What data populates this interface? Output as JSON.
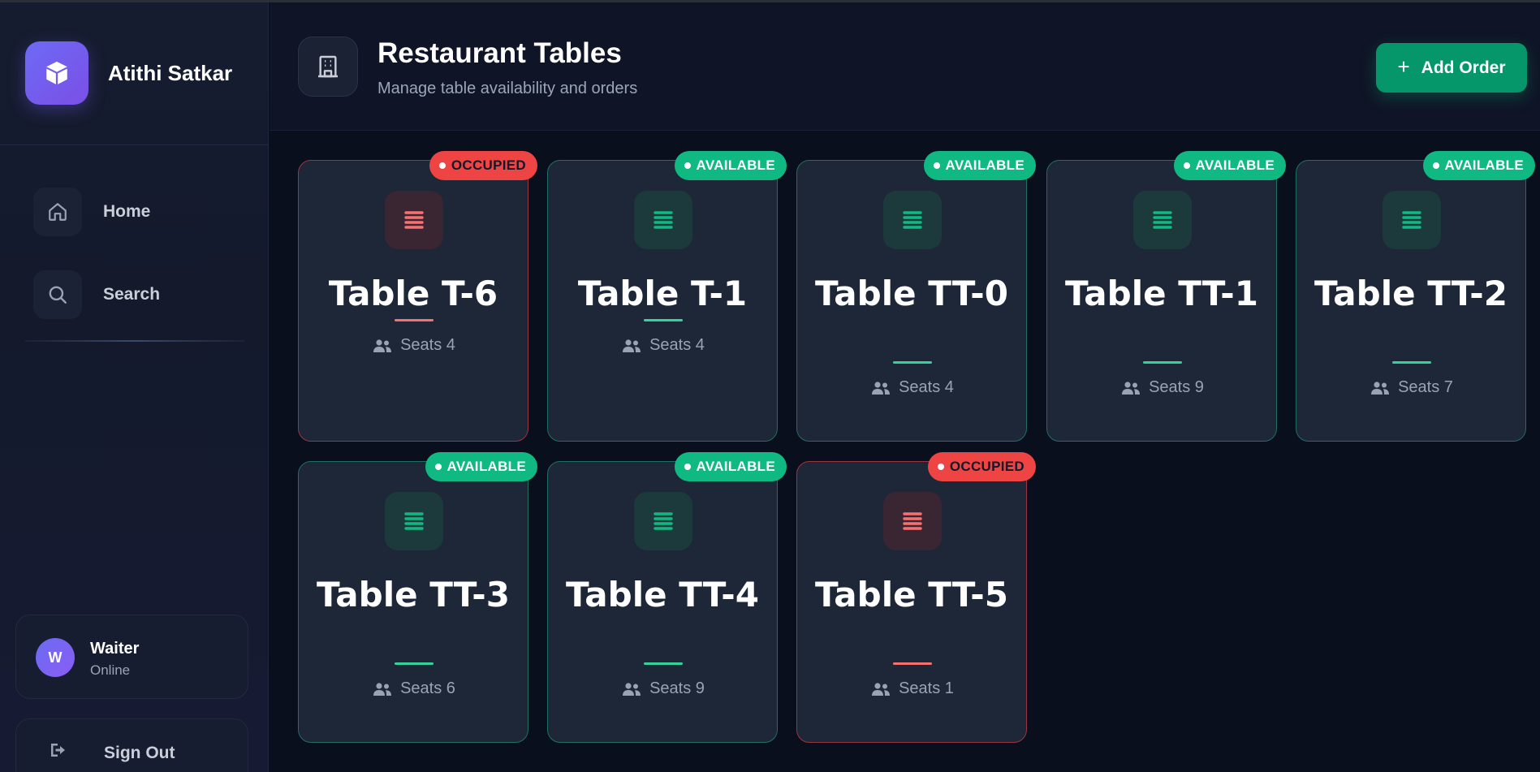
{
  "app": {
    "name": "Atithi Satkar"
  },
  "nav": {
    "items": [
      {
        "label": "Home",
        "icon": "home-icon"
      },
      {
        "label": "Search",
        "icon": "search-icon"
      }
    ]
  },
  "user": {
    "initial": "W",
    "name": "Waiter",
    "status": "Online"
  },
  "signout": {
    "label": "Sign Out",
    "icon": "sign-out-icon"
  },
  "header": {
    "title": "Restaurant Tables",
    "subtitle": "Manage table availability and orders",
    "icon": "building-icon",
    "add_order_label": "Add Order"
  },
  "colors": {
    "available": "#10b981",
    "occupied": "#ef4444",
    "brand": "#6d6af5",
    "accent_button": "#059669"
  },
  "tables": [
    {
      "name": "Table T-6",
      "status": "OCCUPIED",
      "seats": "Seats 4"
    },
    {
      "name": "Table T-1",
      "status": "AVAILABLE",
      "seats": "Seats 4"
    },
    {
      "name": "Table TT-0",
      "status": "AVAILABLE",
      "seats": "Seats 4"
    },
    {
      "name": "Table TT-1",
      "status": "AVAILABLE",
      "seats": "Seats 9"
    },
    {
      "name": "Table TT-2",
      "status": "AVAILABLE",
      "seats": "Seats 7"
    },
    {
      "name": "Table TT-3",
      "status": "AVAILABLE",
      "seats": "Seats 6"
    },
    {
      "name": "Table TT-4",
      "status": "AVAILABLE",
      "seats": "Seats 9"
    },
    {
      "name": "Table TT-5",
      "status": "OCCUPIED",
      "seats": "Seats 1"
    }
  ]
}
